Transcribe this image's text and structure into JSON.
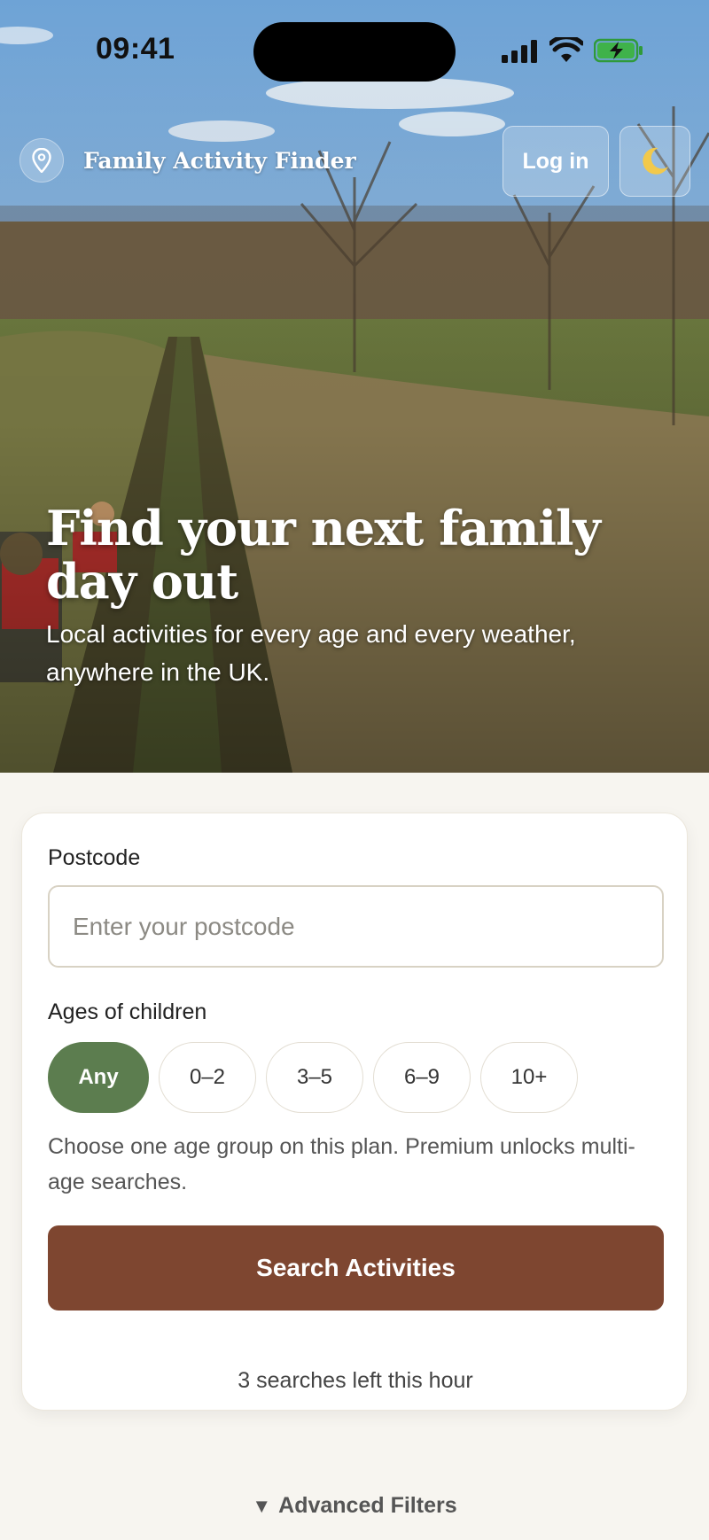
{
  "status_bar": {
    "time": "09:41"
  },
  "header": {
    "brand_title": "Family Activity Finder",
    "login_label": "Log in",
    "theme_icon": "moon-icon"
  },
  "hero": {
    "title": "Find your next family day out",
    "subtitle": "Local activities for every age and every weather, anywhere in the UK."
  },
  "search_card": {
    "postcode_label": "Postcode",
    "postcode_placeholder": "Enter your postcode",
    "postcode_value": "",
    "ages_label": "Ages of children",
    "age_chips": [
      {
        "label": "Any",
        "selected": true
      },
      {
        "label": "0–2",
        "selected": false
      },
      {
        "label": "3–5",
        "selected": false
      },
      {
        "label": "6–9",
        "selected": false
      },
      {
        "label": "10+",
        "selected": false
      }
    ],
    "hint": "Choose one age group on this plan. Premium unlocks multi-age searches.",
    "search_label": "Search Activities",
    "remaining": "3 searches left this hour"
  },
  "advanced_filters": {
    "label": "Advanced Filters",
    "icon": "caret-down-icon"
  },
  "colors": {
    "primary_green": "#5c7d4f",
    "search_button": "#7e4630",
    "page_background": "#f7f5f0"
  }
}
